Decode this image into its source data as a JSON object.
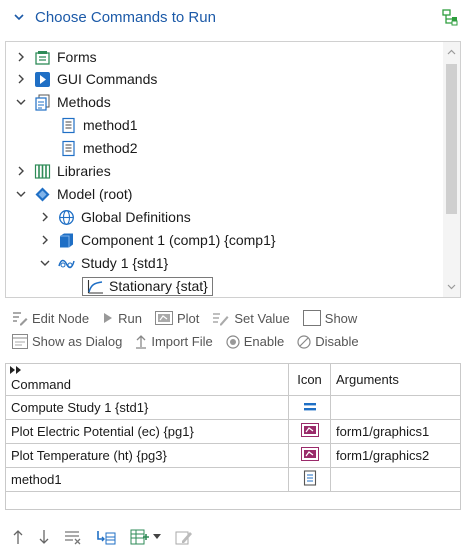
{
  "header": {
    "title": "Choose Commands to Run"
  },
  "tree": {
    "items": [
      {
        "label": "Forms"
      },
      {
        "label": "GUI Commands"
      },
      {
        "label": "Methods"
      },
      {
        "label": "method1"
      },
      {
        "label": "method2"
      },
      {
        "label": "Libraries"
      },
      {
        "label": "Model (root)"
      },
      {
        "label": "Global Definitions"
      },
      {
        "label": "Component 1 (comp1) {comp1}"
      },
      {
        "label": "Study 1 {std1}"
      },
      {
        "label": "Stationary {stat}"
      }
    ]
  },
  "toolbar": {
    "edit_node": "Edit Node",
    "run": "Run",
    "plot": "Plot",
    "set_value": "Set Value",
    "show": "Show",
    "show_as_dialog": "Show as Dialog",
    "import_file": "Import File",
    "enable": "Enable",
    "disable": "Disable"
  },
  "table": {
    "headers": {
      "command": "Command",
      "icon": "Icon",
      "arguments": "Arguments"
    },
    "rows": [
      {
        "command": "Compute Study 1 {std1}",
        "arguments": ""
      },
      {
        "command": "Plot Electric Potential (ec) {pg1}",
        "arguments": "form1/graphics1"
      },
      {
        "command": "Plot Temperature (ht) {pg3}",
        "arguments": "form1/graphics2"
      },
      {
        "command": "method1",
        "arguments": ""
      }
    ]
  },
  "colors": {
    "accent": "#1c5aa8",
    "tree_blue": "#1f6fc5"
  }
}
